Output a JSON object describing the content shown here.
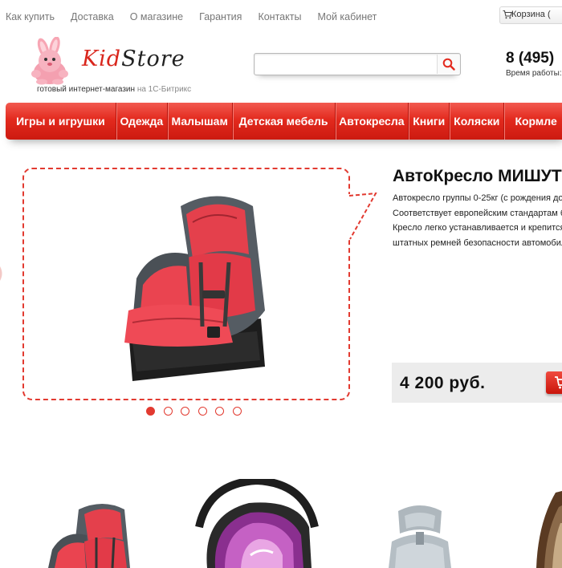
{
  "top_links": [
    "Как купить",
    "Доставка",
    "О магазине",
    "Гарантия",
    "Контакты",
    "Мой кабинет"
  ],
  "cart": {
    "label": "Корзина ("
  },
  "logo": {
    "kid": "Kid",
    "store": "Store"
  },
  "tagline": {
    "main": "готовый интернет-магазин",
    "suffix": "на 1С-Битрикс"
  },
  "search": {
    "value": "",
    "placeholder": ""
  },
  "contact": {
    "phone": "8 (495)",
    "hours": "Время работы:"
  },
  "nav": [
    {
      "label": "Игры и игрушки"
    },
    {
      "label": "Одежда"
    },
    {
      "label": "Малышам"
    },
    {
      "label": "Детская мебель"
    },
    {
      "label": "Автокресла"
    },
    {
      "label": "Книги"
    },
    {
      "label": "Коляски"
    },
    {
      "label": "Кормле"
    }
  ],
  "product": {
    "title": "АвтоКресло МИШУТК",
    "desc": [
      "Автокресло группы 0-25кг (с рождения до",
      "Соответствует европейским стандартам б",
      "Кресло легко устанавливается и крепится",
      "штатных ремней безопасности автомобил"
    ],
    "price": "4 200 руб."
  },
  "slider": {
    "count": 6,
    "active": 0
  },
  "colors": {
    "accent": "#e32a1e",
    "nav_dark": "#b5140c",
    "price_bg": "#ececec"
  },
  "icons": [
    "cart-icon",
    "search-icon",
    "bunny-logo-icon",
    "cart-button-icon"
  ]
}
